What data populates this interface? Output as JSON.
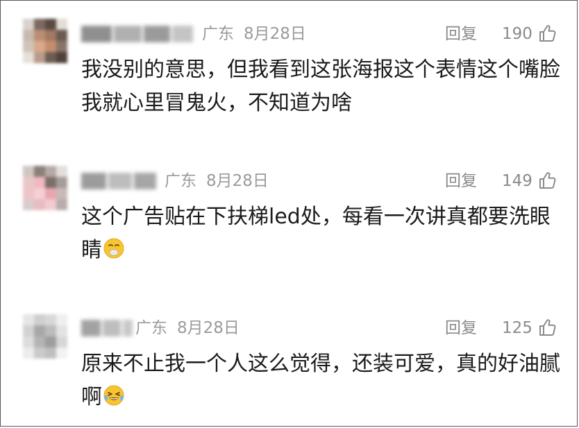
{
  "comments": [
    {
      "location": "广东",
      "date": "8月28日",
      "reply_label": "回复",
      "likes": "190",
      "text": "我没别的意思，但我看到这张海报这个表情这个嘴脸我就心里冒鬼火，不知道为啥",
      "emoji": null
    },
    {
      "location": "广东",
      "date": "8月28日",
      "reply_label": "回复",
      "likes": "149",
      "text": "这个广告贴在下扶梯led处，每看一次讲真都要洗眼睛",
      "emoji": "nauseated-face-icon"
    },
    {
      "location": "广东",
      "date": "8月28日",
      "reply_label": "回复",
      "likes": "125",
      "text": "原来不止我一个人这么觉得，还装可爱，真的好油腻啊",
      "emoji": "crying-laughing-face-icon"
    }
  ],
  "colors": {
    "meta_gray": "#9a9a9a",
    "text_dark": "#1a1a1a",
    "emoji_yellow": "#f7c531"
  }
}
